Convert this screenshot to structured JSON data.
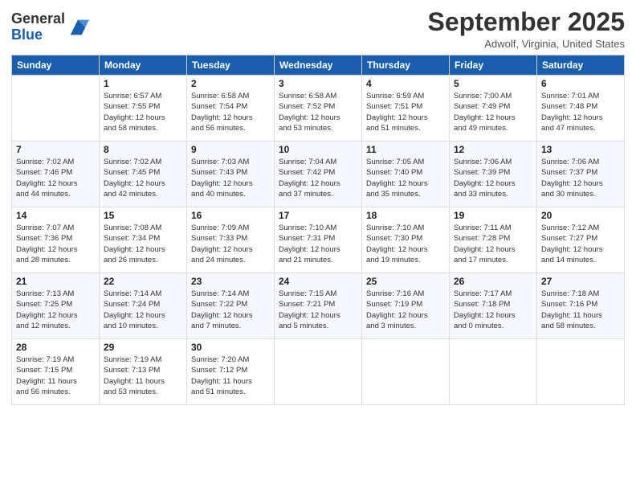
{
  "header": {
    "logo_line1": "General",
    "logo_line2": "Blue",
    "month": "September 2025",
    "location": "Adwolf, Virginia, United States"
  },
  "days_of_week": [
    "Sunday",
    "Monday",
    "Tuesday",
    "Wednesday",
    "Thursday",
    "Friday",
    "Saturday"
  ],
  "weeks": [
    [
      {
        "day": "",
        "info": ""
      },
      {
        "day": "1",
        "info": "Sunrise: 6:57 AM\nSunset: 7:55 PM\nDaylight: 12 hours\nand 58 minutes."
      },
      {
        "day": "2",
        "info": "Sunrise: 6:58 AM\nSunset: 7:54 PM\nDaylight: 12 hours\nand 56 minutes."
      },
      {
        "day": "3",
        "info": "Sunrise: 6:58 AM\nSunset: 7:52 PM\nDaylight: 12 hours\nand 53 minutes."
      },
      {
        "day": "4",
        "info": "Sunrise: 6:59 AM\nSunset: 7:51 PM\nDaylight: 12 hours\nand 51 minutes."
      },
      {
        "day": "5",
        "info": "Sunrise: 7:00 AM\nSunset: 7:49 PM\nDaylight: 12 hours\nand 49 minutes."
      },
      {
        "day": "6",
        "info": "Sunrise: 7:01 AM\nSunset: 7:48 PM\nDaylight: 12 hours\nand 47 minutes."
      }
    ],
    [
      {
        "day": "7",
        "info": "Sunrise: 7:02 AM\nSunset: 7:46 PM\nDaylight: 12 hours\nand 44 minutes."
      },
      {
        "day": "8",
        "info": "Sunrise: 7:02 AM\nSunset: 7:45 PM\nDaylight: 12 hours\nand 42 minutes."
      },
      {
        "day": "9",
        "info": "Sunrise: 7:03 AM\nSunset: 7:43 PM\nDaylight: 12 hours\nand 40 minutes."
      },
      {
        "day": "10",
        "info": "Sunrise: 7:04 AM\nSunset: 7:42 PM\nDaylight: 12 hours\nand 37 minutes."
      },
      {
        "day": "11",
        "info": "Sunrise: 7:05 AM\nSunset: 7:40 PM\nDaylight: 12 hours\nand 35 minutes."
      },
      {
        "day": "12",
        "info": "Sunrise: 7:06 AM\nSunset: 7:39 PM\nDaylight: 12 hours\nand 33 minutes."
      },
      {
        "day": "13",
        "info": "Sunrise: 7:06 AM\nSunset: 7:37 PM\nDaylight: 12 hours\nand 30 minutes."
      }
    ],
    [
      {
        "day": "14",
        "info": "Sunrise: 7:07 AM\nSunset: 7:36 PM\nDaylight: 12 hours\nand 28 minutes."
      },
      {
        "day": "15",
        "info": "Sunrise: 7:08 AM\nSunset: 7:34 PM\nDaylight: 12 hours\nand 26 minutes."
      },
      {
        "day": "16",
        "info": "Sunrise: 7:09 AM\nSunset: 7:33 PM\nDaylight: 12 hours\nand 24 minutes."
      },
      {
        "day": "17",
        "info": "Sunrise: 7:10 AM\nSunset: 7:31 PM\nDaylight: 12 hours\nand 21 minutes."
      },
      {
        "day": "18",
        "info": "Sunrise: 7:10 AM\nSunset: 7:30 PM\nDaylight: 12 hours\nand 19 minutes."
      },
      {
        "day": "19",
        "info": "Sunrise: 7:11 AM\nSunset: 7:28 PM\nDaylight: 12 hours\nand 17 minutes."
      },
      {
        "day": "20",
        "info": "Sunrise: 7:12 AM\nSunset: 7:27 PM\nDaylight: 12 hours\nand 14 minutes."
      }
    ],
    [
      {
        "day": "21",
        "info": "Sunrise: 7:13 AM\nSunset: 7:25 PM\nDaylight: 12 hours\nand 12 minutes."
      },
      {
        "day": "22",
        "info": "Sunrise: 7:14 AM\nSunset: 7:24 PM\nDaylight: 12 hours\nand 10 minutes."
      },
      {
        "day": "23",
        "info": "Sunrise: 7:14 AM\nSunset: 7:22 PM\nDaylight: 12 hours\nand 7 minutes."
      },
      {
        "day": "24",
        "info": "Sunrise: 7:15 AM\nSunset: 7:21 PM\nDaylight: 12 hours\nand 5 minutes."
      },
      {
        "day": "25",
        "info": "Sunrise: 7:16 AM\nSunset: 7:19 PM\nDaylight: 12 hours\nand 3 minutes."
      },
      {
        "day": "26",
        "info": "Sunrise: 7:17 AM\nSunset: 7:18 PM\nDaylight: 12 hours\nand 0 minutes."
      },
      {
        "day": "27",
        "info": "Sunrise: 7:18 AM\nSunset: 7:16 PM\nDaylight: 11 hours\nand 58 minutes."
      }
    ],
    [
      {
        "day": "28",
        "info": "Sunrise: 7:19 AM\nSunset: 7:15 PM\nDaylight: 11 hours\nand 56 minutes."
      },
      {
        "day": "29",
        "info": "Sunrise: 7:19 AM\nSunset: 7:13 PM\nDaylight: 11 hours\nand 53 minutes."
      },
      {
        "day": "30",
        "info": "Sunrise: 7:20 AM\nSunset: 7:12 PM\nDaylight: 11 hours\nand 51 minutes."
      },
      {
        "day": "",
        "info": ""
      },
      {
        "day": "",
        "info": ""
      },
      {
        "day": "",
        "info": ""
      },
      {
        "day": "",
        "info": ""
      }
    ]
  ]
}
